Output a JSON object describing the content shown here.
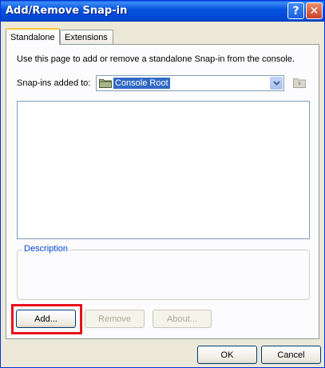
{
  "window": {
    "title": "Add/Remove Snap-in",
    "help_label": "?",
    "close_label": "✕"
  },
  "tabs": [
    {
      "label": "Standalone",
      "active": true
    },
    {
      "label": "Extensions",
      "active": false
    }
  ],
  "standalone": {
    "instruction": "Use this page to add or remove a standalone Snap-in from the console.",
    "snapins_label": "Snap-ins added to:",
    "snapins_value": "Console Root",
    "snapin_list": [],
    "description_label": "Description",
    "add_label": "Add...",
    "remove_label": "Remove",
    "about_label": "About..."
  },
  "footer": {
    "ok_label": "OK",
    "cancel_label": "Cancel"
  },
  "colors": {
    "titlebar": "#0054e3",
    "highlight": "#e8111a",
    "selection": "#316ac5"
  },
  "icons": [
    "folder-icon",
    "chevron-down-icon",
    "folder-up-icon",
    "help-icon",
    "close-icon"
  ]
}
